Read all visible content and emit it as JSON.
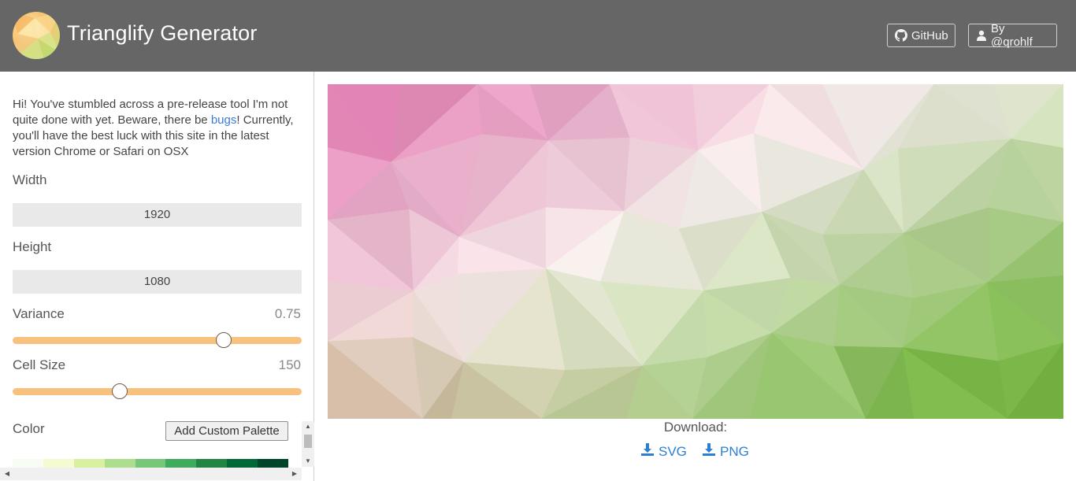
{
  "header": {
    "title": "Trianglify Generator",
    "github_label": "GitHub",
    "author_label": "By @qrohlf"
  },
  "sidebar": {
    "intro_before": "Hi! You've stumbled across a pre-release tool I'm not quite done with yet. Beware, there be ",
    "intro_link": "bugs",
    "intro_after": "! Currently, you'll have the best luck with this site in the latest version Chrome or Safari on OSX",
    "width": {
      "label": "Width",
      "value": "1920"
    },
    "height": {
      "label": "Height",
      "value": "1080"
    },
    "variance": {
      "label": "Variance",
      "value": "0.75",
      "fraction": 0.73
    },
    "cell_size": {
      "label": "Cell Size",
      "value": "150",
      "fraction": 0.37
    },
    "color": {
      "label": "Color",
      "add_button": "Add Custom Palette"
    },
    "palette_colors": [
      "#f7fcf5",
      "#f4fbd0",
      "#d9f0a3",
      "#addd8e",
      "#78c679",
      "#41ab5d",
      "#238443",
      "#006837",
      "#004529"
    ]
  },
  "main": {
    "download_label": "Download:",
    "svg_label": "SVG",
    "png_label": "PNG",
    "accent_color": "#2d7fd3"
  }
}
